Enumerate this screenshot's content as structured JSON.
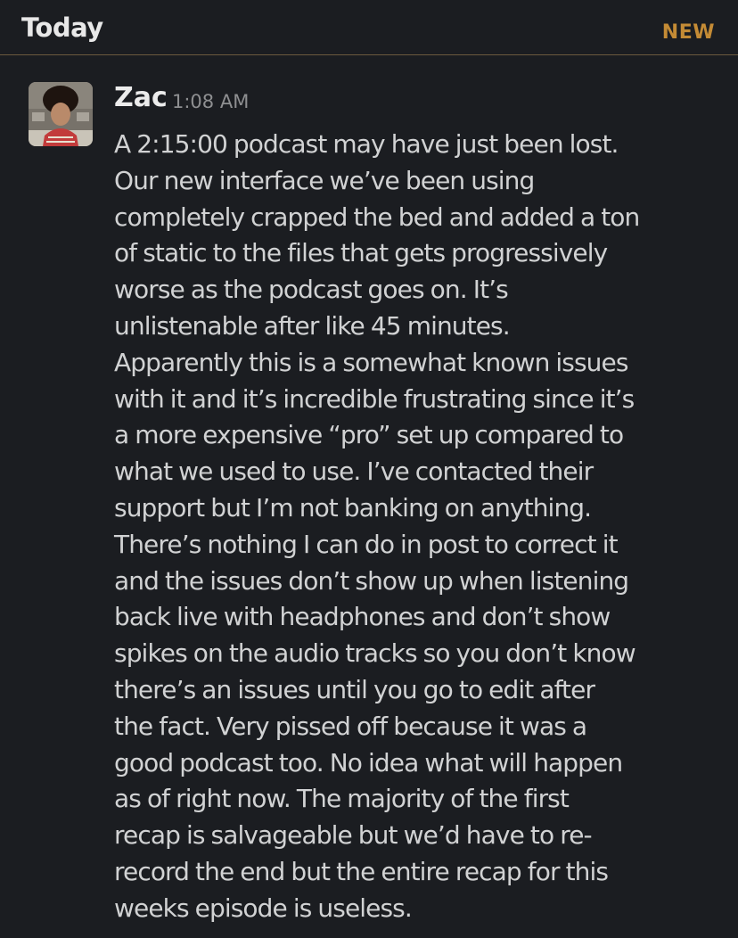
{
  "day_divider": {
    "label": "Today",
    "new_badge": "NEW"
  },
  "message": {
    "sender": "Zac",
    "time": "1:08 AM",
    "lines": [
      "A 2:15:00 podcast may have just been lost.",
      "Our new interface we’ve been using",
      "completely crapped the bed and added a ton",
      "of static to the files that gets progressively",
      "worse as the podcast goes on. It’s",
      "unlistenable after like 45 minutes.",
      "Apparently this is a somewhat known issues",
      "with it and it’s incredible frustrating since it’s",
      "a more expensive “pro” set up compared to",
      "what we used to use. I’ve contacted their",
      "support but I’m not banking on anything.",
      "There’s nothing I can do in post to correct it",
      "and the issues don’t show up when listening",
      "back live with headphones and don’t show",
      "spikes on the audio tracks so you don’t know",
      "there’s an issues until you go to edit after",
      "the fact. Very pissed off because it was a",
      "good podcast too. No idea what will happen",
      "as of right now. The majority of the first",
      "recap is salvageable but we’d have to re-",
      "record the end but the entire recap for this",
      "weeks episode is useless."
    ]
  },
  "colors": {
    "background": "#1b1d21",
    "divider": "#6b5a3e",
    "new_badge": "#c48b35",
    "text": "#d1d2d3",
    "timestamp": "#8e8f91"
  },
  "icons": {
    "avatar": "user-avatar-photo"
  }
}
